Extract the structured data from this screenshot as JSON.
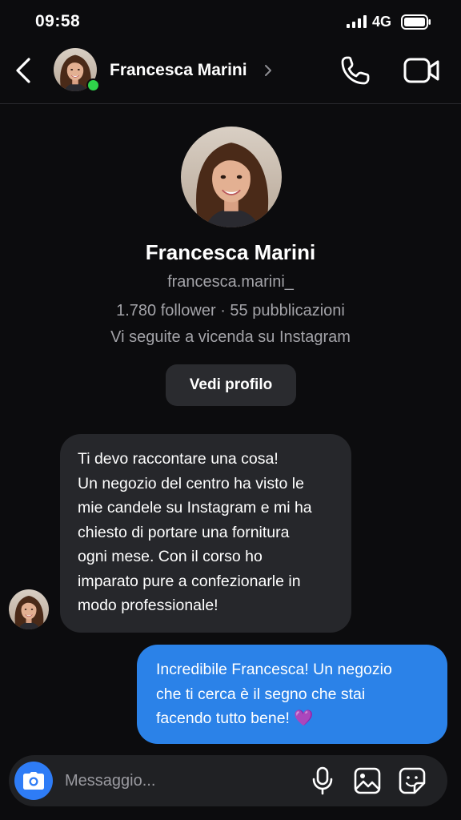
{
  "status_bar": {
    "time": "09:58",
    "network": "4G"
  },
  "header": {
    "name": "Francesca Marini",
    "online": true
  },
  "profile": {
    "name": "Francesca Marini",
    "username": "francesca.marini_",
    "stats": "1.780 follower · 55 pubblicazioni",
    "mutual": "Vi seguite a vicenda su Instagram",
    "view_profile_label": "Vedi profilo"
  },
  "messages": [
    {
      "direction": "incoming",
      "lines": [
        "Ti devo raccontare una cosa!",
        "Un negozio del centro ha visto le",
        "mie candele su Instagram e mi ha",
        "chiesto di portare una fornitura",
        "ogni mese. Con il corso ho",
        "imparato pure a confezionarle in",
        "modo professionale!"
      ]
    },
    {
      "direction": "outgoing",
      "lines": [
        "Incredibile Francesca! Un negozio",
        "che ti cerca è il segno che stai",
        "facendo tutto bene! 💜"
      ]
    }
  ],
  "composer": {
    "placeholder": "Messaggio..."
  },
  "colors": {
    "background": "#0c0c0e",
    "incoming_bubble": "#26272b",
    "outgoing_bubble": "#2b82e8",
    "accent": "#2e7cf6",
    "online": "#2fd24a"
  },
  "icons": [
    "back-icon",
    "call-icon",
    "video-icon",
    "camera-icon",
    "mic-icon",
    "gallery-icon",
    "sticker-icon",
    "signal-icon",
    "battery-icon",
    "chevron-right-icon"
  ]
}
